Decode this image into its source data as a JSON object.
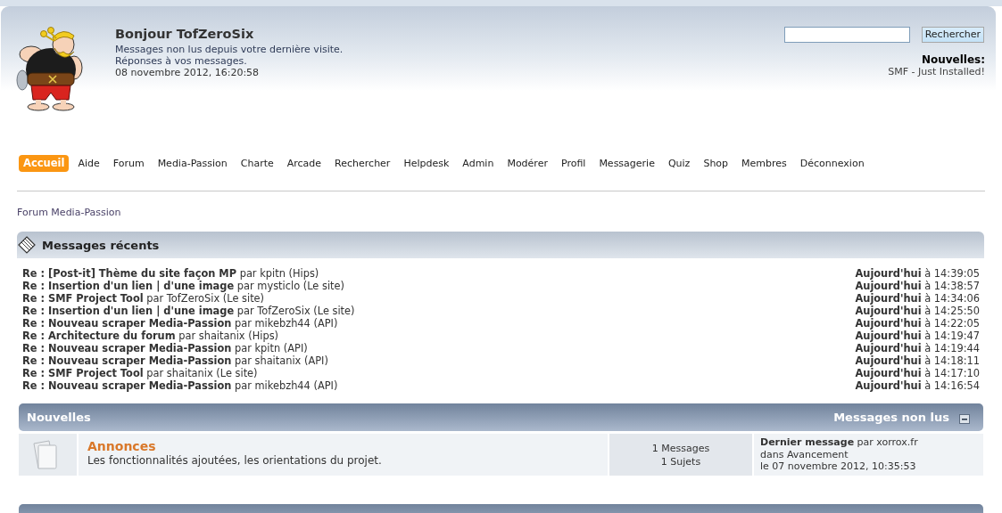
{
  "header": {
    "greeting": "Bonjour TofZeroSix",
    "links": [
      "Messages non lus depuis votre dernière visite.",
      "Réponses à vos messages."
    ],
    "datetime": "08 novembre 2012, 16:20:58"
  },
  "search": {
    "button": "Rechercher"
  },
  "news": {
    "label": "Nouvelles:",
    "text": "SMF - Just Installed!"
  },
  "menu": [
    {
      "label": "Accueil",
      "selected": true
    },
    {
      "label": "Aide",
      "selected": false
    },
    {
      "label": "Forum",
      "selected": false
    },
    {
      "label": "Media-Passion",
      "selected": false
    },
    {
      "label": "Charte",
      "selected": false
    },
    {
      "label": "Arcade",
      "selected": false
    },
    {
      "label": "Rechercher",
      "selected": false
    },
    {
      "label": "Helpdesk",
      "selected": false
    },
    {
      "label": "Admin",
      "selected": false
    },
    {
      "label": "Modérer",
      "selected": false
    },
    {
      "label": "Profil",
      "selected": false
    },
    {
      "label": "Messagerie",
      "selected": false
    },
    {
      "label": "Quiz",
      "selected": false
    },
    {
      "label": "Shop",
      "selected": false
    },
    {
      "label": "Membres",
      "selected": false
    },
    {
      "label": "Déconnexion",
      "selected": false
    }
  ],
  "breadcrumb": [
    "Forum Media-Passion"
  ],
  "recent": {
    "title": "Messages récents",
    "posts": [
      {
        "subject": "Re : [Post-it] Thème du site façon MP",
        "by": "par",
        "poster": "kpitn",
        "board": "(Hips)",
        "when": "**Aujourd'hui** à 14:39:05"
      },
      {
        "subject": "Re : Insertion d'un lien | d'une image",
        "by": "par",
        "poster": "mysticlo",
        "board": "(Le site)",
        "when": "**Aujourd'hui** à 14:38:57"
      },
      {
        "subject": "Re : SMF Project Tool",
        "by": "par",
        "poster": "TofZeroSix",
        "board": "(Le site)",
        "when": "**Aujourd'hui** à 14:34:06"
      },
      {
        "subject": "Re : Insertion d'un lien | d'une image",
        "by": "par",
        "poster": "TofZeroSix",
        "board": "(Le site)",
        "when": "**Aujourd'hui** à 14:25:50"
      },
      {
        "subject": "Re : Nouveau scraper Media-Passion",
        "by": "par",
        "poster": "mikebzh44",
        "board": "(API)",
        "when": "**Aujourd'hui** à 14:22:05"
      },
      {
        "subject": "Re : Architecture du forum",
        "by": "par",
        "poster": "shaitanix",
        "board": "(Hips)",
        "when": "**Aujourd'hui** à 14:19:47"
      },
      {
        "subject": "Re : Nouveau scraper Media-Passion",
        "by": "par",
        "poster": "kpitn",
        "board": "(API)",
        "when": "**Aujourd'hui** à 14:19:44"
      },
      {
        "subject": "Re : Nouveau scraper Media-Passion",
        "by": "par",
        "poster": "shaitanix",
        "board": "(API)",
        "when": "**Aujourd'hui** à 14:18:11"
      },
      {
        "subject": "Re : SMF Project Tool",
        "by": "par",
        "poster": "shaitanix",
        "board": "(Le site)",
        "when": "**Aujourd'hui** à 14:17:10"
      },
      {
        "subject": "Re : Nouveau scraper Media-Passion",
        "by": "par",
        "poster": "mikebzh44",
        "board": "(API)",
        "when": "**Aujourd'hui** à 14:16:54"
      }
    ]
  },
  "categories": [
    {
      "title": "Nouvelles",
      "unread_link": "Messages non lus",
      "expanded": true,
      "boards": [
        {
          "name": "Annonces",
          "description": "Les fonctionnalités ajoutées, les orientations du projet.",
          "new_posts": false,
          "posts": "1 Messages",
          "topics": "1 Sujets",
          "last_post": {
            "label": "Dernier message",
            "by": "par",
            "poster": "xorrox.fr",
            "in": "dans",
            "topic": "Avancement",
            "date": "le 07 novembre 2012, 10:35:53"
          }
        }
      ]
    }
  ]
}
